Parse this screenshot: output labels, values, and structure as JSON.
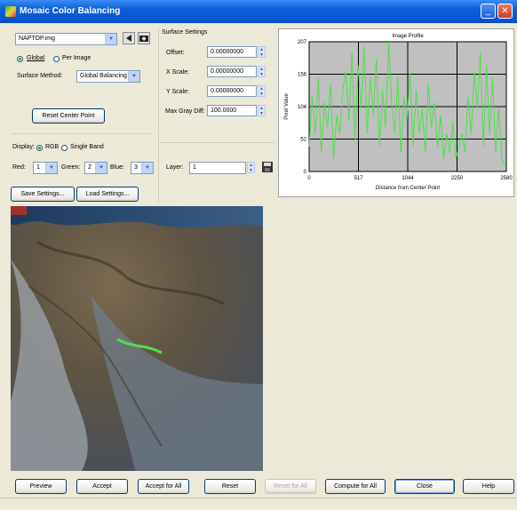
{
  "window": {
    "title": "Mosaic Color Balancing"
  },
  "left_panel": {
    "file_combo": "NAPTOP.img",
    "scope_global": "Global",
    "scope_per_image": "Per Image",
    "surface_method_label": "Surface Method:",
    "surface_method_value": "Global Balancing",
    "reset_center_button": "Reset Center Point",
    "display_label": "Display:",
    "display_rgb": "RGB",
    "display_single": "Single Band",
    "red_label": "Red:",
    "red_value": "1",
    "green_label": "Green:",
    "green_value": "2",
    "blue_label": "Blue:",
    "blue_value": "3",
    "save_settings": "Save Settings...",
    "load_settings": "Load Settings..."
  },
  "surface_settings": {
    "title": "Surface Settings",
    "offset_label": "Offset:",
    "offset_value": "0.00000000",
    "xscale_label": "X Scale:",
    "xscale_value": "0.00000000",
    "yscale_label": "Y Scale:",
    "yscale_value": "0.00000000",
    "maxgray_label": "Max Gray Diff:",
    "maxgray_value": "100.0000",
    "layer_label": "Layer:",
    "layer_value": "1"
  },
  "bottom_buttons": {
    "preview": "Preview",
    "accept": "Accept",
    "accept_all": "Accept for All",
    "reset": "Reset",
    "disabled_btn": "Reset for All",
    "compute_all": "Compute for All",
    "close": "Close",
    "help": "Help"
  },
  "colors": {
    "plot_bg": "#c0c0c0",
    "line": "#4de04d",
    "title_bar": "#0a5fd8"
  },
  "chart_data": {
    "type": "line",
    "title": "Image Profile",
    "xlabel": "Distance from Center Point",
    "ylabel": "Pixel Value",
    "xlim": [
      0,
      2580
    ],
    "ylim": [
      0,
      207
    ],
    "xticks": [
      "0",
      "517",
      "1044",
      "2250",
      "2580"
    ],
    "yticks": [
      "0",
      "52",
      "104",
      "156",
      "207"
    ],
    "grid": true,
    "series": [
      {
        "x": [
          0,
          40,
          80,
          120,
          160,
          200,
          240,
          280,
          320,
          360,
          400,
          440,
          480,
          520,
          560,
          600,
          640,
          680,
          720,
          760,
          800,
          840,
          880,
          920,
          960,
          1000,
          1040,
          1080,
          1120,
          1160,
          1200,
          1240,
          1280,
          1320,
          1360,
          1400,
          1440,
          1480,
          1520,
          1560,
          1600,
          1640,
          1680,
          1720,
          1760,
          1800,
          1840,
          1880,
          1920,
          1960,
          2000,
          2040,
          2080,
          2120,
          2160,
          2200,
          2240,
          2280,
          2320,
          2360,
          2400,
          2440,
          2480,
          2520,
          2560
        ],
        "y": [
          40,
          120,
          60,
          150,
          30,
          110,
          70,
          140,
          20,
          90,
          60,
          130,
          160,
          80,
          190,
          50,
          170,
          100,
          200,
          60,
          150,
          90,
          180,
          40,
          130,
          70,
          207,
          110,
          60,
          150,
          30,
          120,
          80,
          160,
          40,
          130,
          60,
          100,
          30,
          140,
          70,
          110,
          40,
          90,
          20,
          60,
          30,
          80,
          20,
          40,
          60,
          30,
          120,
          60,
          160,
          100,
          190,
          40,
          170,
          60,
          150,
          30,
          100,
          20,
          10
        ]
      }
    ]
  }
}
